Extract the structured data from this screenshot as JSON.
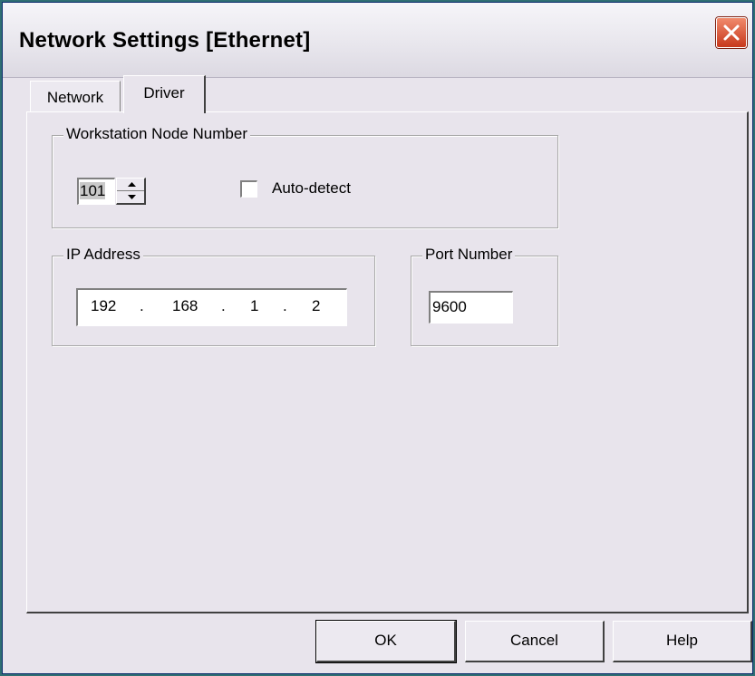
{
  "window": {
    "title": "Network Settings [Ethernet]"
  },
  "tabs": [
    {
      "label": "Network",
      "selected": false
    },
    {
      "label": "Driver",
      "selected": true
    }
  ],
  "node_group": {
    "legend": "Workstation Node Number",
    "node_value": "101",
    "auto_detect_label": "Auto-detect",
    "auto_detect_checked": false
  },
  "ip_group": {
    "legend": "IP Address",
    "octets": [
      "192",
      "168",
      "1",
      "2"
    ],
    "separator": "."
  },
  "port_group": {
    "legend": "Port Number",
    "port_value": "9600"
  },
  "buttons": {
    "ok": "OK",
    "cancel": "Cancel",
    "help": "Help"
  },
  "icons": {
    "close": "close-icon",
    "spin_up": "arrow-up-icon",
    "spin_down": "arrow-down-icon"
  }
}
